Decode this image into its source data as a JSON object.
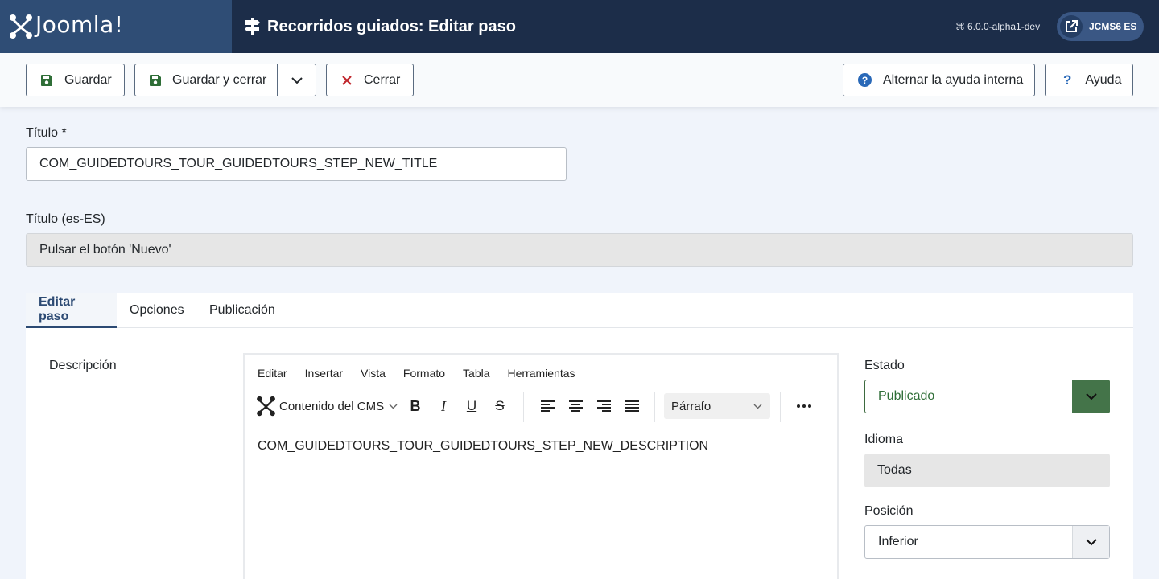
{
  "header": {
    "logo_text": "Joomla!",
    "page_title": "Recorridos guiados: Editar paso",
    "version": "6.0.0-alpha1-dev",
    "site_label": "JCMS6 ES"
  },
  "toolbar": {
    "save": "Guardar",
    "save_close": "Guardar y cerrar",
    "close": "Cerrar",
    "inline_help": "Alternar la ayuda interna",
    "help": "Ayuda"
  },
  "form": {
    "title_label": "Título *",
    "title_value": "COM_GUIDEDTOURS_TOUR_GUIDEDTOURS_STEP_NEW_TITLE",
    "title_lang_label": "Título (es-ES)",
    "title_lang_value": "Pulsar el botón 'Nuevo'"
  },
  "tabs": [
    "Editar paso",
    "Opciones",
    "Publicación"
  ],
  "editor": {
    "label": "Descripción",
    "menu": [
      "Editar",
      "Insertar",
      "Vista",
      "Formato",
      "Tabla",
      "Herramientas"
    ],
    "cms_content": "Contenido del CMS",
    "block_format": "Párrafo",
    "content": "COM_GUIDEDTOURS_TOUR_GUIDEDTOURS_STEP_NEW_DESCRIPTION"
  },
  "side": {
    "status_label": "Estado",
    "status_value": "Publicado",
    "language_label": "Idioma",
    "language_value": "Todas",
    "position_label": "Posición",
    "position_value": "Inferior"
  },
  "colors": {
    "header_bg": "#1c2d49",
    "logo_bg": "#2f4d75",
    "accent": "#2c4a73",
    "published": "#447449",
    "close_red": "#c0262c"
  }
}
